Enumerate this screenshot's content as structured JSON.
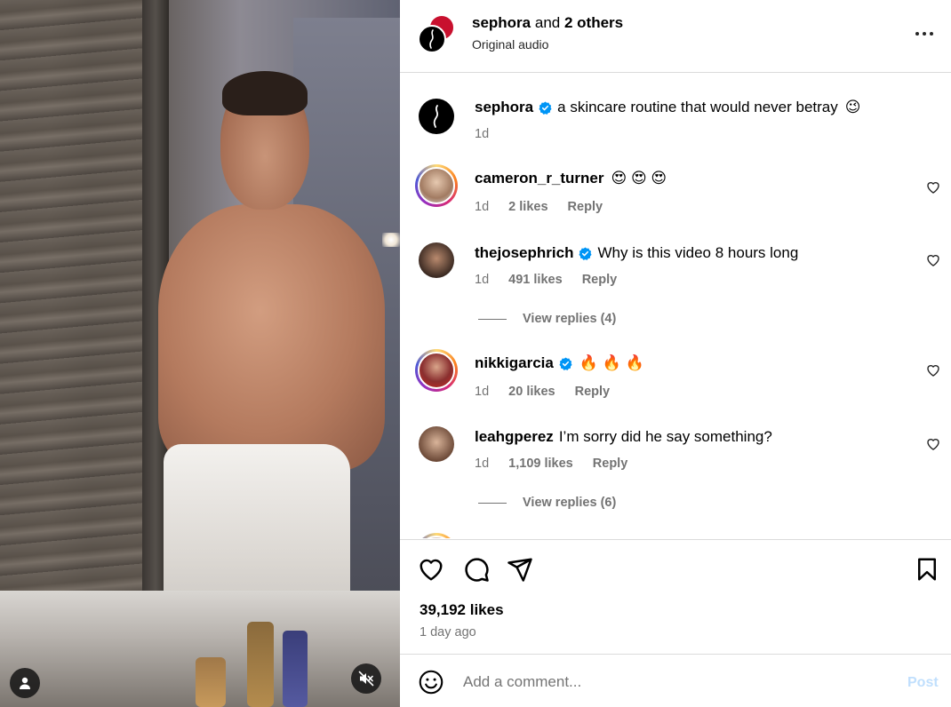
{
  "header": {
    "owner": "sephora",
    "joiner": "and",
    "others": "2 others",
    "subtitle": "Original audio",
    "more_icon": "more-horizontal-icon"
  },
  "caption": {
    "username": "sephora",
    "text": "a skincare routine that would never betray",
    "emoji": "😉",
    "time": "1d"
  },
  "comments": [
    {
      "username": "cameron_r_turner",
      "verified": false,
      "text": "",
      "emoji": "😍 😍 😍",
      "time": "1d",
      "likes": "2 likes",
      "reply": "Reply"
    },
    {
      "username": "thejosephrich",
      "verified": true,
      "text": "Why is this video 8 hours long",
      "emoji": "",
      "time": "1d",
      "likes": "491 likes",
      "reply": "Reply",
      "view_replies": "View replies (4)"
    },
    {
      "username": "nikkigarcia",
      "verified": true,
      "text": "",
      "emoji": "🔥 🔥 🔥",
      "time": "1d",
      "likes": "20 likes",
      "reply": "Reply"
    },
    {
      "username": "leahgperez",
      "verified": false,
      "text": "I’m sorry did he say something?",
      "emoji": "",
      "time": "1d",
      "likes": "1,109 likes",
      "reply": "Reply",
      "view_replies": "View replies (6)"
    }
  ],
  "actions": {
    "likes": "39,192 likes",
    "time": "1 day ago"
  },
  "add_comment": {
    "placeholder": "Add a comment...",
    "post_label": "Post"
  },
  "colors": {
    "verified": "#0095f6",
    "sephora_red": "#c8102e",
    "post_disabled": "#c0dffd",
    "muted_text": "#737373"
  }
}
